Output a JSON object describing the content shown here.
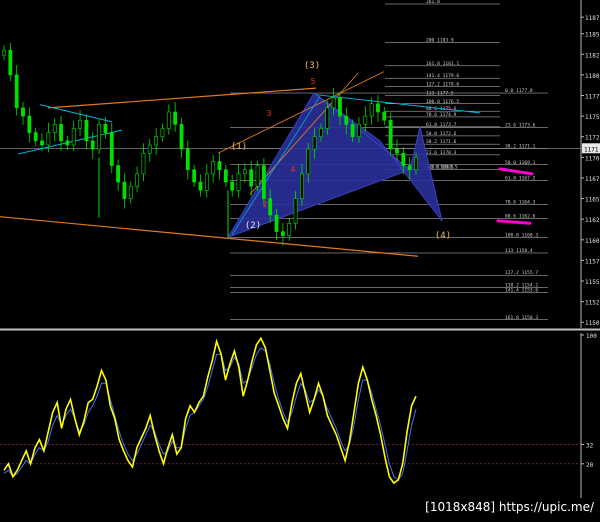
{
  "price_axis": {
    "ticks": [
      1187.0,
      1185.0,
      1182.5,
      1180.0,
      1177.5,
      1175.0,
      1172.5,
      1170.0,
      1167.5,
      1165.0,
      1162.5,
      1160.0,
      1157.5,
      1155.0,
      1152.5,
      1150.0
    ],
    "tick_labels": [
      "1187",
      "1185.",
      "1182.",
      "1180.",
      "1177.",
      "1175.",
      "1172.",
      "1170.",
      "1167.",
      "1165.",
      "1162.",
      "1160.",
      "1157.",
      "1155.",
      "1152.",
      "1150."
    ],
    "current_price_label": "1171",
    "range": [
      1149.3,
      1188.6
    ]
  },
  "oscillator_axis": {
    "ticks": [
      100,
      32,
      20
    ],
    "tick_labels": [
      "100",
      "32",
      "20"
    ],
    "range": [
      0,
      100
    ]
  },
  "fib_levels_right": [
    {
      "price": 1188.6,
      "text": "261.8"
    },
    {
      "price": 1183.9,
      "text": "200 1183.9"
    },
    {
      "price": 1181.1,
      "text": "161.8 1181.1"
    },
    {
      "price": 1179.6,
      "text": "141.4 1179.6"
    },
    {
      "price": 1178.6,
      "text": "127.2 1178.6"
    },
    {
      "price": 1177.5,
      "text": "113 1177.5"
    },
    {
      "price": 1176.5,
      "text": "100.0 1176.5"
    },
    {
      "price": 1175.6,
      "text": "88.6 1175.6"
    },
    {
      "price": 1174.9,
      "text": "78.6 1174.9"
    },
    {
      "price": 1173.7,
      "text": "61.8 1173.7"
    },
    {
      "price": 1172.6,
      "text": "50.0 1172.6"
    },
    {
      "price": 1171.6,
      "text": "38.2 1171.6"
    },
    {
      "price": 1170.3,
      "text": "23.6 1170.3"
    },
    {
      "price": 1168.5,
      "text": "0.0 1168.5"
    }
  ],
  "fib_levels_right_short": [
    {
      "price": 1177.8,
      "text": "0.0 1177.8"
    },
    {
      "price": 1173.6,
      "text": "23.6 1173.6"
    },
    {
      "price": 1171.1,
      "text": "38.2 1171.1"
    },
    {
      "price": 1169.1,
      "text": "50.0 1169.1"
    },
    {
      "price": 1167.2,
      "text": "61.8 1167.2"
    },
    {
      "price": 1164.3,
      "text": "78.6 1164.3"
    },
    {
      "price": 1162.6,
      "text": "88.6 1162.6"
    },
    {
      "price": 1160.3,
      "text": "100.0 1160.3"
    },
    {
      "price": 1158.4,
      "text": "113 1158.4"
    },
    {
      "price": 1155.7,
      "text": "127.2 1155.7"
    },
    {
      "price": 1154.2,
      "text": "138.2 1154.2"
    },
    {
      "price": 1153.6,
      "text": "141.4 1153.6"
    },
    {
      "price": 1150.3,
      "text": "161.8 1150.3"
    }
  ],
  "wave_labels": [
    {
      "text": "(1)",
      "color": "#e8c050"
    },
    {
      "text": "(2)",
      "color": "#e8e8e8"
    },
    {
      "text": "(3)",
      "color": "#e8c050"
    },
    {
      "text": "(4)",
      "color": "#e8c050"
    },
    {
      "text": "5",
      "color": "#ff3010"
    },
    {
      "text": "3",
      "color": "#ff3010"
    },
    {
      "text": "4",
      "color": "#ff3010"
    },
    {
      "text": "2",
      "color": "#ff3010"
    }
  ],
  "colors": {
    "up_candle": "#00e000",
    "down_candle": "#00e000",
    "pattern_fill": "#2a2f9a",
    "trend_orange": "#e07820",
    "trend_cyan": "#00b0e0",
    "highlight_magenta": "#ff00cc",
    "osc_fast": "#ffff00",
    "osc_slow": "#4a6cff",
    "separator": "#c0c0c0"
  },
  "watermark": "[1018x848] https://upic.me/",
  "chart_data": [
    {
      "type": "candlestick",
      "title": "",
      "ylim": [
        1149.3,
        1188.6
      ],
      "close_path": [
        1183,
        1180,
        1176,
        1175,
        1173,
        1172,
        1171.5,
        1173,
        1174,
        1172,
        1171.5,
        1173.5,
        1174.5,
        1172,
        1171,
        1174,
        1173,
        1169,
        1167,
        1165,
        1166.5,
        1168,
        1170.5,
        1171.5,
        1172.5,
        1173.5,
        1175.5,
        1174,
        1171,
        1168.5,
        1167,
        1166,
        1168,
        1169.5,
        1168.5,
        1167,
        1166,
        1168,
        1168.5,
        1166.5,
        1169,
        1165,
        1163,
        1161,
        1160.5,
        1162,
        1165,
        1168,
        1171,
        1172.5,
        1173.5,
        1176,
        1177.2,
        1175,
        1174,
        1172.5,
        1174,
        1175,
        1176.5,
        1175.5,
        1174.5,
        1171,
        1170.5,
        1169,
        1168.5,
        1170
      ],
      "fib_low": 1160.3,
      "fib_high": 1177.8
    },
    {
      "type": "line",
      "title": "",
      "ylim": [
        0,
        100
      ],
      "series": [
        {
          "values": [
            16,
            20,
            12,
            16,
            22,
            28,
            20,
            30,
            35,
            28,
            40,
            52,
            58,
            42,
            54,
            60,
            48,
            38,
            46,
            58,
            60,
            68,
            78,
            72,
            56,
            48,
            35,
            28,
            22,
            18,
            30,
            36,
            42,
            50,
            38,
            28,
            20,
            30,
            38,
            26,
            30,
            48,
            56,
            52,
            58,
            62,
            74,
            84,
            96,
            88,
            72,
            82,
            90,
            80,
            62,
            72,
            84,
            94,
            98,
            92,
            78,
            64,
            56,
            48,
            42,
            58,
            70,
            76,
            64,
            52,
            60,
            70,
            62,
            50,
            44,
            38,
            30,
            22,
            34,
            52,
            70,
            80,
            72,
            60,
            50,
            38,
            24,
            12,
            8,
            10,
            20,
            40,
            56,
            62
          ]
        },
        {
          "values": [
            14,
            16,
            12,
            14,
            18,
            22,
            20,
            26,
            30,
            28,
            34,
            44,
            50,
            44,
            50,
            54,
            48,
            40,
            44,
            52,
            56,
            62,
            70,
            70,
            60,
            50,
            40,
            32,
            26,
            22,
            26,
            32,
            38,
            44,
            40,
            32,
            26,
            28,
            34,
            30,
            30,
            42,
            50,
            52,
            56,
            60,
            68,
            78,
            88,
            88,
            78,
            80,
            86,
            82,
            70,
            72,
            80,
            88,
            92,
            90,
            82,
            70,
            60,
            52,
            46,
            52,
            62,
            70,
            66,
            58,
            60,
            66,
            62,
            54,
            48,
            42,
            34,
            28,
            32,
            44,
            60,
            72,
            72,
            64,
            54,
            44,
            32,
            20,
            12,
            10,
            14,
            28,
            44,
            54
          ]
        }
      ]
    }
  ]
}
